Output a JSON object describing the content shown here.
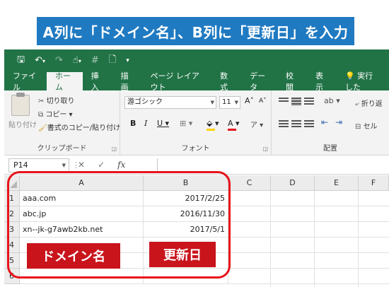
{
  "banner": {
    "text": "A列に「ドメイン名」、B列に「更新日」を入力"
  },
  "qat": {
    "save": "🖫",
    "undo": "↶",
    "undo_arrow": "▾",
    "redo": "↷",
    "touch": "☝",
    "touch_arrow": "▾",
    "hash": "#",
    "preview": "🗋",
    "more": "▾"
  },
  "tabs": [
    "ファイル",
    "ホーム",
    "挿入",
    "描画",
    "ページ レイアウト",
    "数式",
    "データ",
    "校閲",
    "表示",
    "💡 実行した"
  ],
  "active_tab": "ホーム",
  "ribbon": {
    "clipboard": {
      "paste": "貼り付け",
      "cut": "切り取り",
      "copy": "コピー ▾",
      "format_painter": "書式のコピー/貼り付け",
      "label": "クリップボード"
    },
    "font": {
      "font_name": "游ゴシック",
      "font_size": "11",
      "grow": "A˄",
      "shrink": "A˅",
      "bold": "B",
      "italic": "I",
      "underline": "U ▾",
      "border": "⊞ ▾",
      "fill": "⬙ ▾",
      "color": "A ▾",
      "phonetic": "ア ▾",
      "label": "フォント"
    },
    "alignment": {
      "wrap": "折り返",
      "merge": "セル",
      "label": "配置"
    }
  },
  "formula_bar": {
    "namebox": "P14",
    "cancel": "✕",
    "enter": "✓",
    "fx": "fx",
    "dots": "⋮"
  },
  "sheet": {
    "columns": [
      "A",
      "B",
      "C",
      "D",
      "E",
      "F"
    ],
    "rows": [
      {
        "n": "1",
        "a": "aaa.com",
        "b": "2017/2/25"
      },
      {
        "n": "2",
        "a": "abc.jp",
        "b": "2016/11/30"
      },
      {
        "n": "3",
        "a": "xn--jk-g7awb2kb.net",
        "b": "2017/5/1"
      },
      {
        "n": "4",
        "a": "",
        "b": ""
      },
      {
        "n": "5",
        "a": "",
        "b": ""
      },
      {
        "n": "6",
        "a": "",
        "b": ""
      }
    ]
  },
  "tags": {
    "domain": "ドメイン名",
    "updated": "更新日"
  },
  "colors": {
    "excel_green": "#217346",
    "banner_blue": "#1f7ac2",
    "highlight_red": "#e8141c",
    "tag_red": "#c9141c"
  }
}
